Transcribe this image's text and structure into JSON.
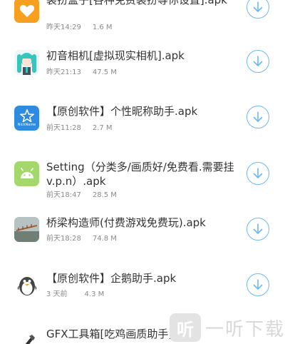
{
  "downloads": [
    {
      "icon": "orange-heart-app-icon",
      "title": "装扮盒子[各种免费装扮等你设置].apk",
      "time": "昨天14:29",
      "size": "1.6 M",
      "colors": {
        "icon_bg": "#f7a01f"
      }
    },
    {
      "icon": "miku-avatar-icon",
      "title": "初音相机[虚拟现实相机].apk",
      "time": "昨天21:13",
      "size": "47.5 M",
      "colors": {
        "icon_bg": "#eef6f8"
      }
    },
    {
      "icon": "blue-star-app-icon",
      "title": "【原创软件】个性昵称助手.apk",
      "time": "前天11:28",
      "size": "2.7 M",
      "icon_caption": "NickName",
      "colors": {
        "icon_bg": "#2f8be0"
      }
    },
    {
      "icon": "android-robot-icon",
      "title": "Setting（分类多/画质好/免费看.需要挂v.p.n）.apk",
      "time": "前天18:47",
      "size": "28.5 M",
      "colors": {
        "icon_bg": "#a4d86c"
      }
    },
    {
      "icon": "bridge-photo-icon",
      "title": "桥梁构造师(付费游戏免费玩).apk",
      "time": "前天18:28",
      "size": "74.8 M",
      "colors": {
        "icon_bg": "#7f8f8a"
      }
    },
    {
      "icon": "penguin-icon",
      "title": "【原创软件】企鹅助手.apk",
      "time": "3 天前",
      "size": "4.3 M",
      "colors": {
        "icon_bg": "#ffffff"
      }
    },
    {
      "icon": "gfx-tool-icon",
      "title": "GFX工具箱[吃鸡画质助手].apk",
      "time": "",
      "size": "",
      "colors": {
        "icon_bg": "#ffffff"
      }
    }
  ],
  "watermark": {
    "logo_char": "听",
    "text": "一听下载"
  },
  "colors": {
    "accent": "#69b9ef",
    "title": "#333333",
    "meta": "#8a8a8a"
  }
}
